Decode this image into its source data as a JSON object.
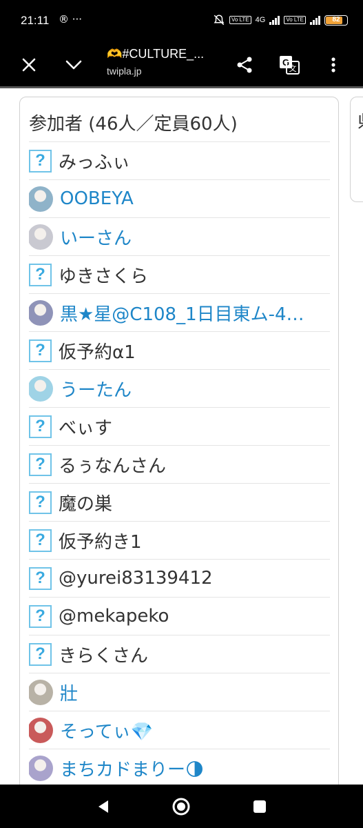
{
  "status_bar": {
    "time": "21:11",
    "left_icons": "® ···",
    "network_4g": "4G",
    "volte_1": "Vo LTE",
    "volte_2": "Vo LTE",
    "battery_level": "82",
    "battery_fraction": 0.82,
    "battery_color": "#f2a43a"
  },
  "toolbar": {
    "title_emoji": "🫶",
    "title": "#CULTURE_...",
    "url": "twipla.jp",
    "icons": [
      "close-icon",
      "chevron-down-icon",
      "share-icon",
      "translate-icon",
      "more-vert-icon"
    ]
  },
  "participants": {
    "title": "参加者 (46人／定員60人)",
    "next_panel_title": "県",
    "link_color": "#1e86c8",
    "items": [
      {
        "name": "みっふぃ",
        "icon": "question",
        "link": false
      },
      {
        "name": "OOBEYA",
        "icon": "avatar",
        "link": true,
        "avatar_color": "#8fb3c9"
      },
      {
        "name": "いーさん",
        "icon": "avatar",
        "link": true,
        "avatar_color": "#c9c9d1"
      },
      {
        "name": "ゆきさくら",
        "icon": "question",
        "link": false
      },
      {
        "name": "黒★星@C108_1日目東ム-4…",
        "icon": "avatar",
        "link": true,
        "avatar_color": "#8f93b8"
      },
      {
        "name": "仮予約α1",
        "icon": "question",
        "link": false
      },
      {
        "name": "うーたん",
        "icon": "avatar",
        "link": true,
        "avatar_color": "#9fd3e6"
      },
      {
        "name": "べぃす",
        "icon": "question",
        "link": false
      },
      {
        "name": "るぅなんさん",
        "icon": "question",
        "link": false
      },
      {
        "name": "魔の巣",
        "icon": "question",
        "link": false
      },
      {
        "name": "仮予約き1",
        "icon": "question",
        "link": false
      },
      {
        "name": " @yurei83139412",
        "icon": "question",
        "link": false
      },
      {
        "name": " @mekapeko",
        "icon": "question",
        "link": false
      },
      {
        "name": "きらくさん",
        "icon": "question",
        "link": false
      },
      {
        "name": "壯",
        "icon": "avatar",
        "link": true,
        "avatar_color": "#b8b2a6"
      },
      {
        "name": "そってぃ💎",
        "icon": "avatar",
        "link": true,
        "avatar_color": "#c95a5a"
      },
      {
        "name": "まちカドまりー🌗",
        "icon": "avatar",
        "link": true,
        "avatar_color": "#a9a3cc"
      }
    ]
  },
  "nav_bar": {
    "buttons": [
      "back-icon",
      "home-icon",
      "recents-icon"
    ]
  }
}
